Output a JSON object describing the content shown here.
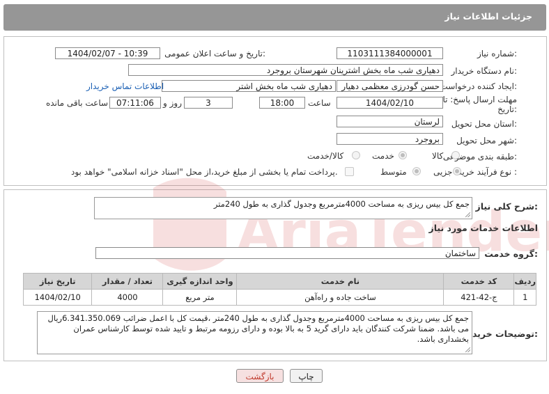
{
  "header": {
    "title": "جزئیات اطلاعات نیاز"
  },
  "form": {
    "need_number_label": "شماره نیاز:",
    "need_number": "1103111384000001",
    "announce_label": "تاریخ و ساعت اعلان عمومی:",
    "announce_value": "1404/02/07 - 10:39",
    "buyer_org_label": "نام دستگاه خریدار:",
    "buyer_org": "دهیاری شب ماه بخش اشترینان شهرستان بروجرد",
    "creator_label": "ایجاد کننده درخواست:",
    "creator": "حسن گودرزی معظمی دهیار",
    "creator_org": "دهیاری شب ماه بخش اشتر",
    "contact_link": "اطلاعات تماس خریدار",
    "deadline_label_1": "مهلت ارسال پاسخ: تا",
    "deadline_label_2": "تاریخ:",
    "deadline_date": "1404/02/10",
    "time_label": "ساعت",
    "deadline_time": "18:00",
    "days_value": "3",
    "days_label": "روز و",
    "remaining_time": "07:11:06",
    "remaining_label": "ساعت باقی مانده",
    "province_label": "استان محل تحویل:",
    "province": "لرستان",
    "city_label": "شهر محل تحویل:",
    "city": "بروجرد",
    "category_label": "طبقه بندی موضوعی:",
    "category_options": [
      "کالا",
      "خدمت",
      "کالا/خدمت"
    ],
    "category_selected": "خدمت",
    "process_label": "نوع فرآیند خرید :",
    "process_options": [
      "جزیی",
      "متوسط"
    ],
    "process_selected": "جزیی",
    "payment_note": "پرداخت تمام یا بخشی از مبلغ خرید،از محل \"اسناد خزانه اسلامی\" خواهد بود."
  },
  "summary": {
    "label": "شرح کلی نیاز:",
    "text": "جمع کل بیس ریزی به مساحت 4000مترمربع وجدول گذاری به طول 240متر"
  },
  "services": {
    "section_title": "اطلاعات خدمات مورد نیاز",
    "group_label": "گروه خدمت:",
    "group_value": "ساختمان",
    "columns": [
      "ردیف",
      "کد خدمت",
      "نام خدمت",
      "واحد اندازه گیری",
      "تعداد / مقدار",
      "تاریخ نیاز"
    ],
    "rows": [
      [
        "1",
        "ج-42-421",
        "ساخت جاده و راه‌آهن",
        "متر مربع",
        "4000",
        "1404/02/10"
      ]
    ]
  },
  "buyer_notes": {
    "label": "توضیحات خریدار:",
    "text": "جمع کل بیس ریزی به مساحت 4000مترمربع وجدول گذاری به طول 240متر ،قیمت کل با اعمل ضرائب 6.341.350.069ریال می باشد. ضمنا شرکت کنندگان باید دارای گرید 5 به بالا بوده و دارای رزومه مرتبط و تایید شده توسط کارشناس عمران بخشداری  باشد."
  },
  "buttons": {
    "print": "چاپ",
    "back": "بازگشت"
  },
  "watermark": {
    "text": "AriaTender.net"
  },
  "colors": {
    "header_bg": "#969696",
    "link": "#1a5fb4",
    "back_text": "#c0392b"
  }
}
